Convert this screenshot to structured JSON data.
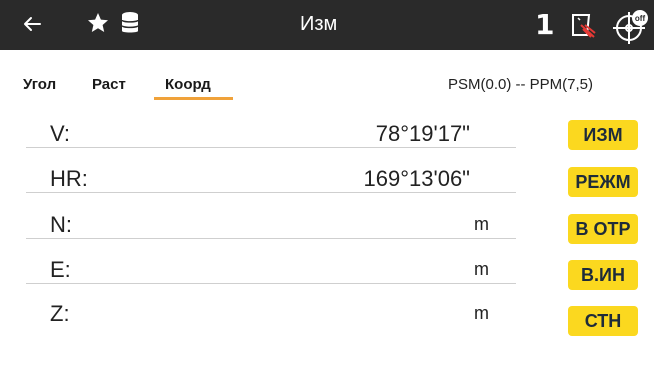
{
  "header": {
    "title": "Изм",
    "job_number": "1",
    "icons": [
      "back-arrow-icon",
      "star-icon",
      "database-icon",
      "laser-icon",
      "compensator-off-icon"
    ],
    "compensator_badge": "off"
  },
  "tabs": [
    {
      "label": "Угол",
      "active": false
    },
    {
      "label": "Раст",
      "active": false
    },
    {
      "label": "Коорд",
      "active": true
    }
  ],
  "status": {
    "psm_ppm": "PSM(0.0) -- PPM(7,5)"
  },
  "rows": [
    {
      "label": "V:",
      "value": "78°19'17\"",
      "unit": ""
    },
    {
      "label": "HR:",
      "value": "169°13'06\"",
      "unit": ""
    },
    {
      "label": "N:",
      "value": "",
      "unit": "m"
    },
    {
      "label": "E:",
      "value": "",
      "unit": "m"
    },
    {
      "label": "Z:",
      "value": "",
      "unit": "m"
    }
  ],
  "buttons": [
    {
      "label": "ИЗМ"
    },
    {
      "label": "РЕЖМ"
    },
    {
      "label": "В ОТР"
    },
    {
      "label": "В.ИН"
    },
    {
      "label": "СТН"
    }
  ],
  "colors": {
    "topbar": "#2a2a2a",
    "accent_tab": "#f0a23a",
    "button": "#fbd81f",
    "laser_red": "#e53935"
  }
}
